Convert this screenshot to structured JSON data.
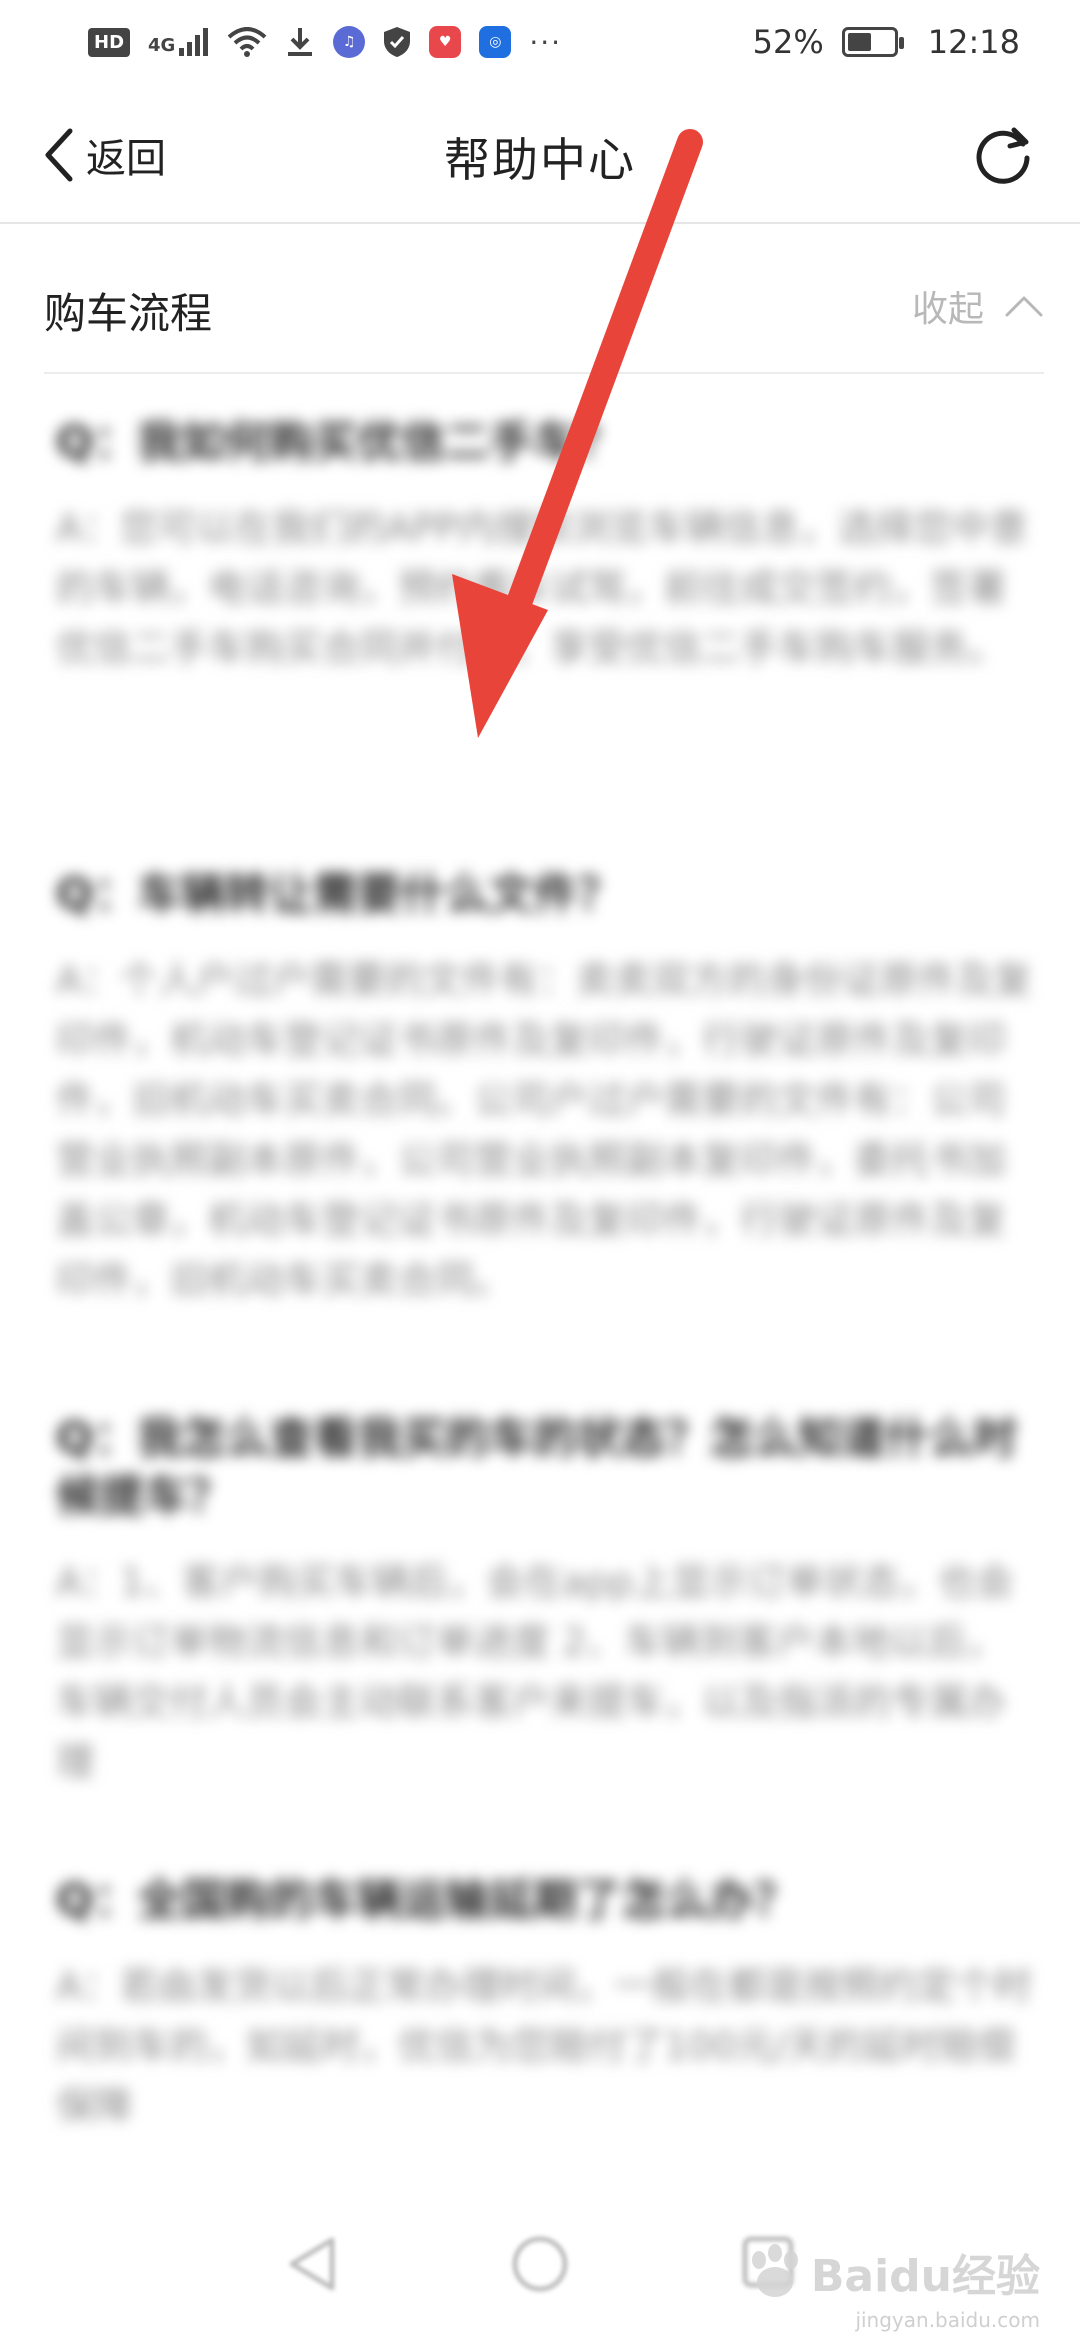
{
  "status_bar": {
    "network_badge": "HD",
    "signal_label": "4G",
    "battery_text": "52%",
    "battery_level": 0.52,
    "time": "12:18",
    "more": "···",
    "app_icons": [
      {
        "name": "download-icon"
      },
      {
        "name": "music-app-icon",
        "color": "#5b6bd6"
      },
      {
        "name": "shield-icon"
      },
      {
        "name": "huawei-app-icon",
        "color": "#e8484b"
      },
      {
        "name": "lightbulb-app-icon",
        "color": "#1f6fe0"
      }
    ]
  },
  "header": {
    "back_label": "返回",
    "title": "帮助中心"
  },
  "section": {
    "title": "购车流程",
    "collapse_label": "收起"
  },
  "faq": [
    {
      "q": "Q：我如何购买优信二手车？",
      "a": "A：您可以在我们的APP内搜索浏览车辆信息，选择您中意的车辆，电话咨询，预约看车试驾，前往成交签约，签署优信二手车购买合同并付款，享受优信二手车购车服务。"
    },
    {
      "q": "Q：车辆转让需要什么文件？",
      "a": "A：个人户过户需要的文件有：卖卖双方的身份证原件及复印件，机动车登记证书原件及复印件，行驶证原件及复印件，旧机动车买卖合同。公司户过户需要的文件有：公司营业执照副本原件，公司营业执照副本复印件，委托书加盖公章，机动车登记证书原件及复印件，行驶证原件及复印件，旧机动车买卖合同。"
    },
    {
      "q": "Q：我怎么查看我买的车的状态？怎么知道什么时候提车？",
      "a": "A：1、客户购买车辆后，会在app上显示订单状态，也会显示订单物流信息和订单进度 2、车辆到客户本地以后，车辆交付人员会主动联系客户来提车，以及指派的专属办理"
    },
    {
      "q": "Q：全国购的车辆运输延期了怎么办？",
      "a": "A：若由发货以后正常办理时间，一般在都是按照约定个时间到车的，如延时，优信为您赔付了100元/天的延时赔偿保障"
    }
  ],
  "watermark": {
    "brand": "Baidu经验",
    "sub": "jingyan.baidu.com"
  }
}
